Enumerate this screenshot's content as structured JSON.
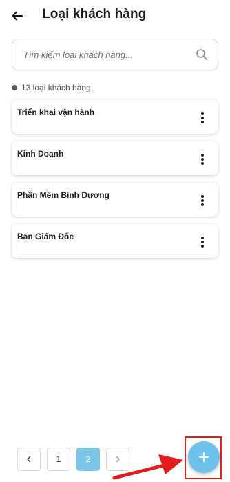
{
  "header": {
    "title": "Loại khách hàng",
    "back_icon": "arrow-left-icon"
  },
  "search": {
    "placeholder": "Tìm kiếm loại khách hàng...",
    "value": "",
    "icon": "search-icon"
  },
  "summary": {
    "count_text": "13 loại khách hàng"
  },
  "items": [
    {
      "label": "Triển khai vận hành"
    },
    {
      "label": "Kinh Doanh"
    },
    {
      "label": "Phần Mềm Bình Dương"
    },
    {
      "label": "Ban Giám Đốc"
    }
  ],
  "pagination": {
    "pages": [
      "1",
      "2"
    ],
    "current": "2",
    "prev_icon": "chevron-left-icon",
    "next_icon": "chevron-right-icon"
  },
  "fab": {
    "icon": "plus-icon"
  },
  "colors": {
    "accent": "#6ec0ea",
    "active_page": "#7cc6e8",
    "highlight": "#e21b1b"
  }
}
